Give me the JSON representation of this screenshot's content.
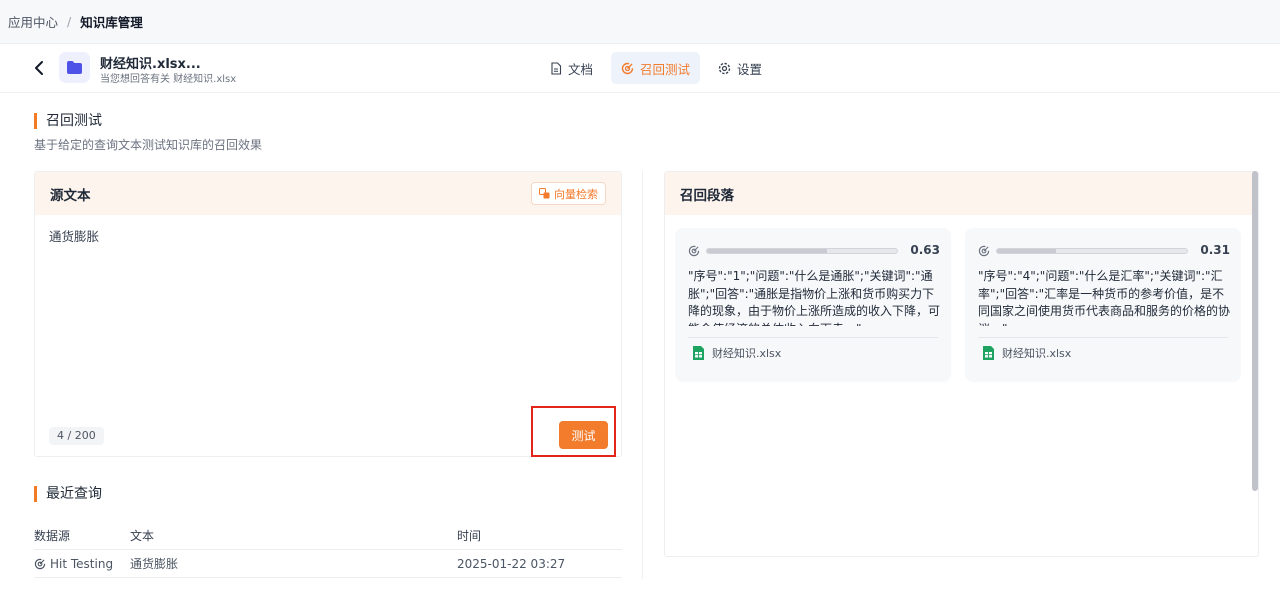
{
  "breadcrumb": {
    "root": "应用中心",
    "separator": "/",
    "current": "知识库管理"
  },
  "kb": {
    "name": "财经知识.xlsx...",
    "desc": "当您想回答有关 财经知识.xlsx"
  },
  "tabs": [
    {
      "label": "文档",
      "icon": "document-icon",
      "active": false
    },
    {
      "label": "召回测试",
      "icon": "recall-icon",
      "active": true
    },
    {
      "label": "设置",
      "icon": "gear-icon",
      "active": false
    }
  ],
  "section": {
    "title": "召回测试",
    "subtitle": "基于给定的查询文本测试知识库的召回效果"
  },
  "source": {
    "header": "源文本",
    "vector_btn": "向量检索",
    "text": "通货膨胀",
    "counter": "4 / 200",
    "test_btn": "测试"
  },
  "recent": {
    "title": "最近查询",
    "columns": [
      "数据源",
      "文本",
      "时间"
    ],
    "rows": [
      {
        "source": "Hit Testing",
        "text": "通货膨胀",
        "time": "2025-01-22 03:27"
      }
    ]
  },
  "results": {
    "header": "召回段落",
    "items": [
      {
        "score": "0.63",
        "score_value": 0.63,
        "text": "\"序号\":\"1\";\"问题\":\"什么是通胀\";\"关键词\":\"通胀\";\"回答\":\"通胀是指物价上涨和货币购买力下降的现象，由于物价上涨所造成的收入下降，可能会使经济的总体收入向下走。\"",
        "file": "财经知识.xlsx"
      },
      {
        "score": "0.31",
        "score_value": 0.31,
        "text": "\"序号\":\"4\";\"问题\":\"什么是汇率\";\"关键词\":\"汇率\";\"回答\":\"汇率是一种货币的参考价值，是不同国家之间使用货币代表商品和服务的价格的协议。\"",
        "file": "财经知识.xlsx"
      }
    ]
  },
  "colors": {
    "accent": "#f27b2c",
    "highlight": "#e3241b",
    "header_bg": "#fdf4ed"
  }
}
